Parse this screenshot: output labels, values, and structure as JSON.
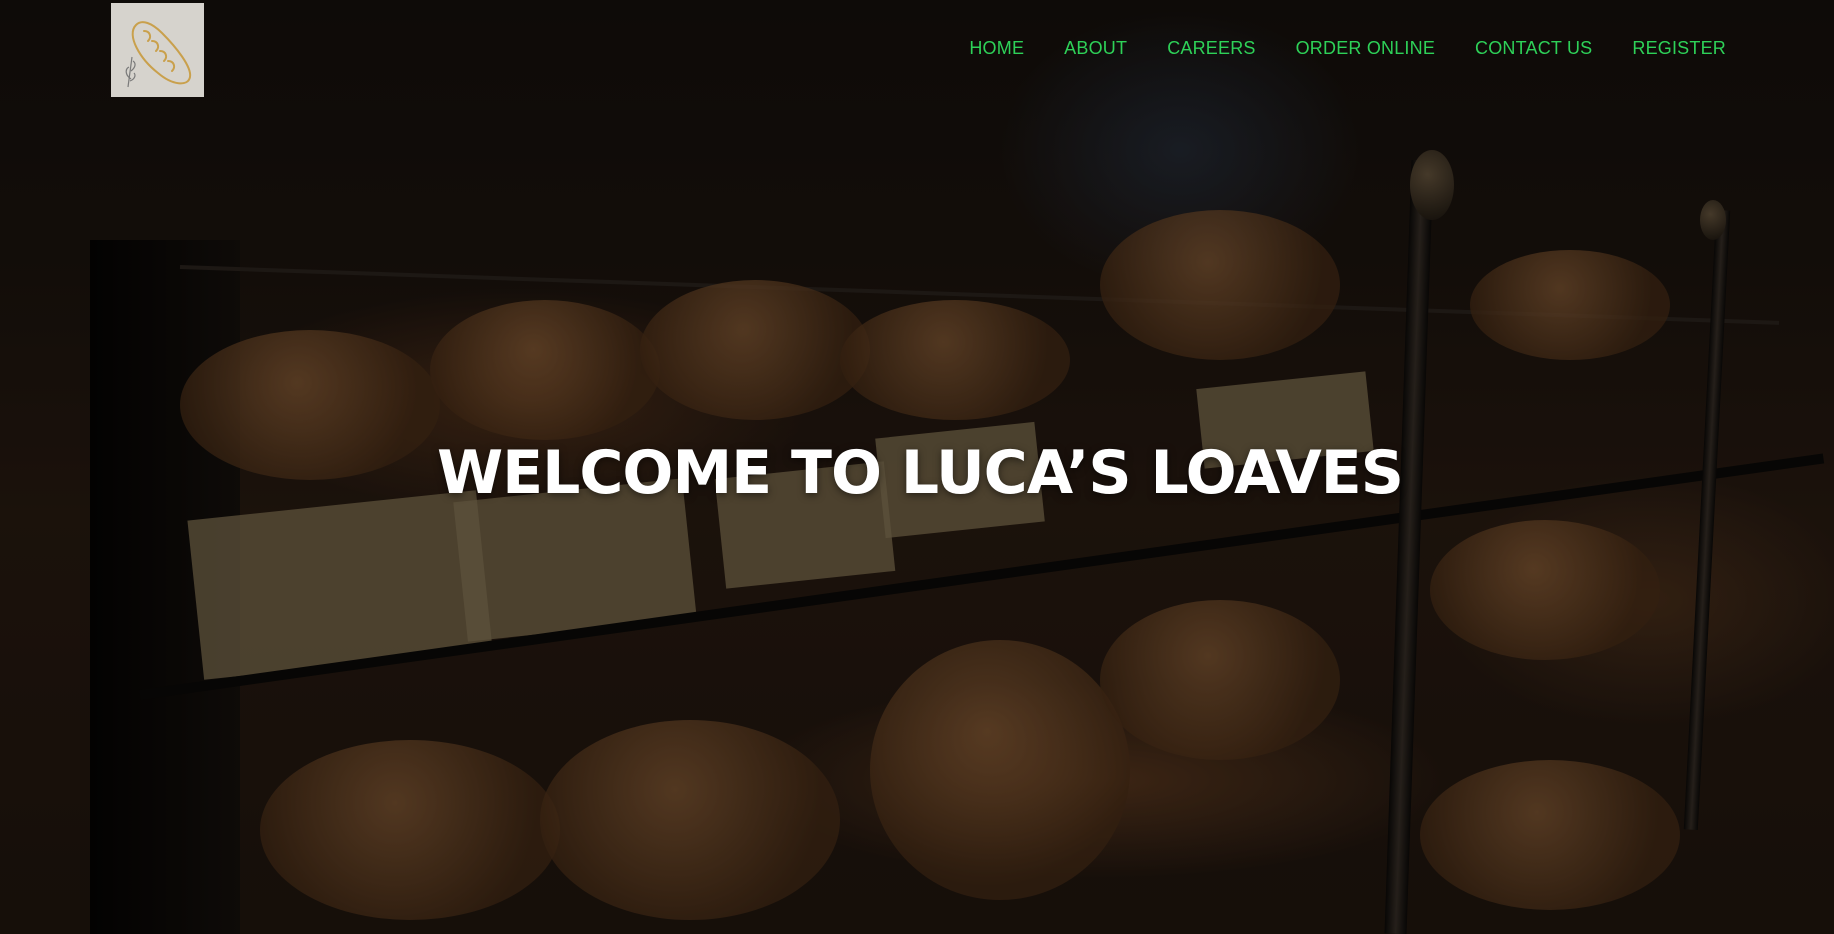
{
  "brand": {
    "logo_icon": "bread-loaf-icon"
  },
  "nav": {
    "items": [
      {
        "label": "HOME"
      },
      {
        "label": "ABOUT"
      },
      {
        "label": "CAREERS"
      },
      {
        "label": "ORDER ONLINE"
      },
      {
        "label": "CONTACT US"
      },
      {
        "label": "REGISTER"
      }
    ]
  },
  "hero": {
    "title": "WELCOME TO LUCA’S LOAVES",
    "background_image": "bakery-display-case"
  },
  "colors": {
    "nav_link": "#2ed158",
    "title": "#ffffff",
    "logo_bg": "#d6d3cd",
    "logo_stroke": "#c9a04c"
  }
}
